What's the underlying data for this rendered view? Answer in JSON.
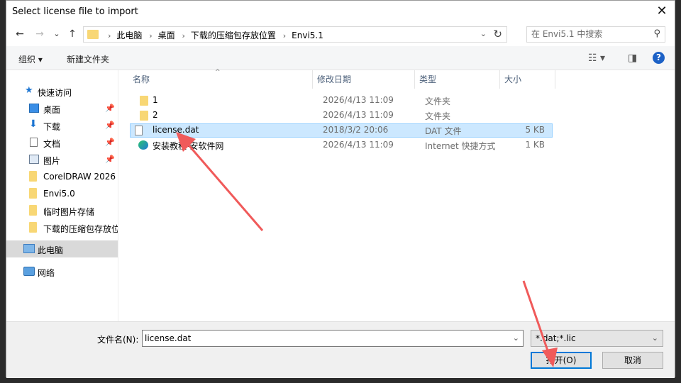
{
  "window": {
    "title": "Select license file to import",
    "close_glyph": "✕"
  },
  "nav": {
    "back_glyph": "←",
    "forward_glyph": "→",
    "recent_glyph": "⌄",
    "up_glyph": "↑",
    "breadcrumbs": [
      "此电脑",
      "桌面",
      "下载的压缩包存放位置",
      "Envi5.1"
    ],
    "search_placeholder": "在 Envi5.1 中搜索"
  },
  "toolbar": {
    "organize_label": "组织 ▾",
    "new_folder_label": "新建文件夹",
    "help_glyph": "?"
  },
  "sidebar": {
    "items": [
      {
        "label": "快速访问",
        "icon": "star-icon",
        "pinned": false
      },
      {
        "label": "桌面",
        "icon": "desktop-icon",
        "pinned": true
      },
      {
        "label": "下载",
        "icon": "download-icon",
        "pinned": true
      },
      {
        "label": "文档",
        "icon": "document-icon",
        "pinned": true
      },
      {
        "label": "图片",
        "icon": "picture-icon",
        "pinned": true
      },
      {
        "label": "CorelDRAW 2026",
        "icon": "folder-icon",
        "pinned": false
      },
      {
        "label": "Envi5.0",
        "icon": "folder-icon",
        "pinned": false
      },
      {
        "label": "临时图片存储",
        "icon": "folder-icon",
        "pinned": false
      },
      {
        "label": "下载的压缩包存放位",
        "icon": "folder-icon",
        "pinned": false
      },
      {
        "label": "此电脑",
        "icon": "computer-icon",
        "pinned": false
      },
      {
        "label": "网络",
        "icon": "network-icon",
        "pinned": false
      }
    ]
  },
  "filelist": {
    "columns": [
      "名称",
      "修改日期",
      "类型",
      "大小"
    ],
    "rows": [
      {
        "name": "1",
        "date": "2026/4/13 11:09",
        "type": "文件夹",
        "size": "",
        "icon": "folder-icon"
      },
      {
        "name": "2",
        "date": "2026/4/13 11:09",
        "type": "文件夹",
        "size": "",
        "icon": "folder-icon"
      },
      {
        "name": "license.dat",
        "date": "2018/3/2 20:06",
        "type": "DAT 文件",
        "size": "5 KB",
        "icon": "file-icon",
        "selected": true
      },
      {
        "name": "安装教程-安软件网",
        "date": "2026/4/13 11:09",
        "type": "Internet 快捷方式",
        "size": "1 KB",
        "icon": "edge-icon"
      }
    ]
  },
  "footer": {
    "filename_label": "文件名(N):",
    "filename_value": "license.dat",
    "filetype_value": "*.dat;*.lic",
    "open_label": "打开(O)",
    "cancel_label": "取消"
  },
  "colors": {
    "accent": "#0078d7",
    "selection": "#cce8ff",
    "annotation_arrow": "#f05a5a"
  }
}
